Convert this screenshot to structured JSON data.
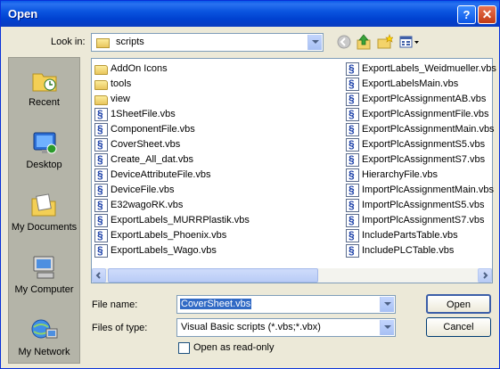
{
  "window": {
    "title": "Open",
    "help_label": "?",
    "close_label": "✕"
  },
  "lookin": {
    "label": "Look in:",
    "value": "scripts"
  },
  "places": [
    {
      "label": "Recent"
    },
    {
      "label": "Desktop"
    },
    {
      "label": "My Documents"
    },
    {
      "label": "My Computer"
    },
    {
      "label": "My Network"
    }
  ],
  "files_col1": [
    {
      "name": "AddOn Icons",
      "type": "folder"
    },
    {
      "name": "tools",
      "type": "folder"
    },
    {
      "name": "view",
      "type": "folder"
    },
    {
      "name": "1SheetFile.vbs",
      "type": "vbs"
    },
    {
      "name": "ComponentFile.vbs",
      "type": "vbs"
    },
    {
      "name": "CoverSheet.vbs",
      "type": "vbs"
    },
    {
      "name": "Create_All_dat.vbs",
      "type": "vbs"
    },
    {
      "name": "DeviceAttributeFile.vbs",
      "type": "vbs"
    },
    {
      "name": "DeviceFile.vbs",
      "type": "vbs"
    },
    {
      "name": "E32wagoRK.vbs",
      "type": "vbs"
    },
    {
      "name": "ExportLabels_MURRPlastik.vbs",
      "type": "vbs"
    },
    {
      "name": "ExportLabels_Phoenix.vbs",
      "type": "vbs"
    },
    {
      "name": "ExportLabels_Wago.vbs",
      "type": "vbs"
    }
  ],
  "files_col2": [
    {
      "name": "ExportLabels_Weidmueller.vbs",
      "type": "vbs"
    },
    {
      "name": "ExportLabelsMain.vbs",
      "type": "vbs"
    },
    {
      "name": "ExportPlcAssignmentAB.vbs",
      "type": "vbs"
    },
    {
      "name": "ExportPlcAssignmentFile.vbs",
      "type": "vbs"
    },
    {
      "name": "ExportPlcAssignmentMain.vbs",
      "type": "vbs"
    },
    {
      "name": "ExportPlcAssignmentS5.vbs",
      "type": "vbs"
    },
    {
      "name": "ExportPlcAssignmentS7.vbs",
      "type": "vbs"
    },
    {
      "name": "HierarchyFile.vbs",
      "type": "vbs"
    },
    {
      "name": "ImportPlcAssignmentMain.vbs",
      "type": "vbs"
    },
    {
      "name": "ImportPlcAssignmentS5.vbs",
      "type": "vbs"
    },
    {
      "name": "ImportPlcAssignmentS7.vbs",
      "type": "vbs"
    },
    {
      "name": "IncludePartsTable.vbs",
      "type": "vbs"
    },
    {
      "name": "IncludePLCTable.vbs",
      "type": "vbs"
    }
  ],
  "filename": {
    "label": "File name:",
    "value": "CoverSheet.vbs"
  },
  "filetype": {
    "label": "Files of type:",
    "value": "Visual Basic scripts (*.vbs;*.vbx)"
  },
  "readonly": {
    "label": "Open as read-only",
    "checked": false
  },
  "buttons": {
    "open": "Open",
    "cancel": "Cancel"
  }
}
